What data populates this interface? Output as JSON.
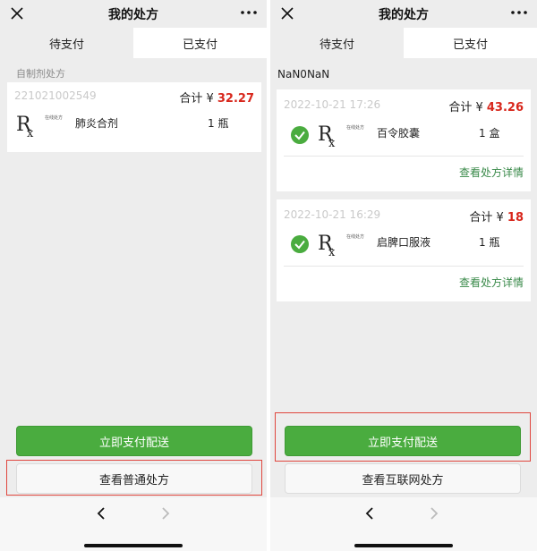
{
  "screens": [
    {
      "title": "我的处方",
      "tabs": [
        {
          "label": "待支付",
          "active": false
        },
        {
          "label": "已支付",
          "active": true
        }
      ],
      "section_label": "自制剂处方",
      "cards": [
        {
          "order_id": "221021002549",
          "total_label": "合计 ¥ ",
          "total_amount": "32.27",
          "rx_label": "在线处方",
          "drug": "肺炎合剂",
          "qty": "1 瓶"
        }
      ],
      "pay_button": "立即支付配送",
      "view_button": "查看普通处方"
    },
    {
      "title": "我的处方",
      "tabs": [
        {
          "label": "待支付",
          "active": false
        },
        {
          "label": "已支付",
          "active": true
        }
      ],
      "section_label": "NaN0NaN",
      "cards": [
        {
          "date": "2022-10-21 17:26",
          "total_label": "合计 ¥ ",
          "total_amount": "43.26",
          "rx_label": "在线处方",
          "drug": "百令胶囊",
          "qty": "1 盒",
          "detail_link": "查看处方详情"
        },
        {
          "date": "2022-10-21 16:29",
          "total_label": "合计 ¥ ",
          "total_amount": "18",
          "rx_label": "在线处方",
          "drug": "启脾口服液",
          "qty": "1 瓶",
          "detail_link": "查看处方详情"
        }
      ],
      "pay_button": "立即支付配送",
      "view_button": "查看互联网处方"
    }
  ],
  "colors": {
    "accent_green": "#4aac3f",
    "link_green": "#3a8a4a",
    "price_red": "#d8271c",
    "highlight_red": "#e0463e"
  },
  "icons": [
    "close-icon",
    "more-icon",
    "rx-icon",
    "check-circle-icon",
    "back-icon",
    "forward-icon"
  ]
}
